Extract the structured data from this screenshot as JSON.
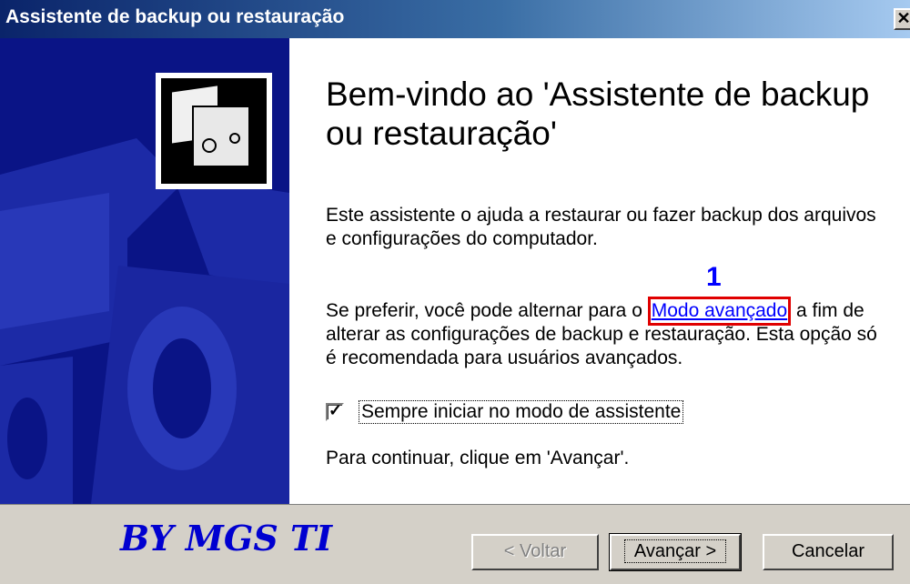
{
  "window": {
    "title": "Assistente de backup ou restauração",
    "close_label": "✕"
  },
  "main": {
    "heading": "Bem-vindo ao 'Assistente de backup ou restauração'",
    "paragraph1": "Este assistente o ajuda a restaurar ou fazer backup dos arquivos e configurações do computador.",
    "paragraph2_before": "Se preferir, você pode alternar para o ",
    "link_text": "Modo avançado",
    "paragraph2_after": " a fim de alterar as configurações de backup e restauração. Esta opção só é recomendada para usuários avançados.",
    "annotation_number": "1",
    "checkbox_label": "Sempre iniciar no modo de assistente",
    "checkbox_checked": true,
    "continue_text": "Para continuar, clique em 'Avançar'."
  },
  "footer": {
    "watermark": "BY MGS TI",
    "back_button": "< Voltar",
    "next_button": "Avançar >",
    "cancel_button": "Cancelar"
  },
  "colors": {
    "side_panel": "#0a1486",
    "link": "#0000ff",
    "annotation_box": "#e00000",
    "watermark": "#0000d0"
  }
}
